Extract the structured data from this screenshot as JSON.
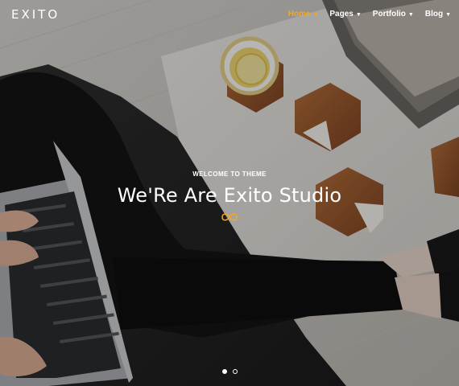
{
  "brand": {
    "logo_text": "EXITO"
  },
  "nav": {
    "items": [
      {
        "label": "Home",
        "active": true
      },
      {
        "label": "Pages",
        "active": false
      },
      {
        "label": "Portfolio",
        "active": false
      },
      {
        "label": "Blog",
        "active": false
      }
    ]
  },
  "hero": {
    "kicker": "WELCOME TO THEME",
    "headline": "We'Re Are Exito Studio",
    "accent_color": "#f5a623"
  },
  "slider": {
    "total_slides": 2,
    "active_index": 0
  }
}
